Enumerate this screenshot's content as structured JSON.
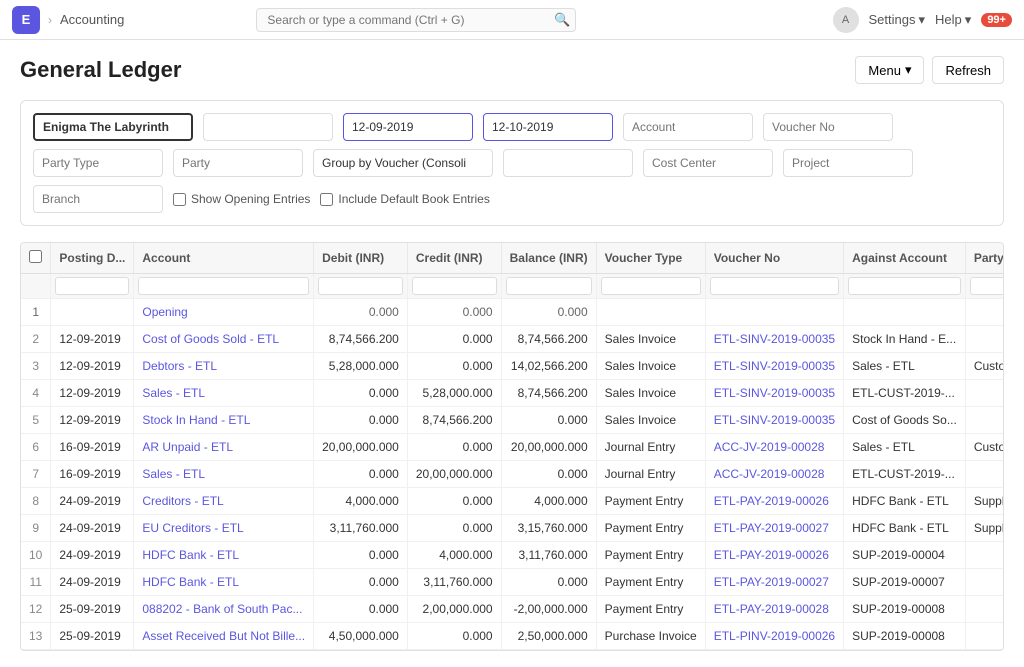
{
  "topbar": {
    "logo": "E",
    "module": "Accounting",
    "search_placeholder": "Search or type a command (Ctrl + G)",
    "avatar_label": "A",
    "settings_label": "Settings",
    "help_label": "Help",
    "badge": "99+"
  },
  "page": {
    "title": "General Ledger",
    "menu_label": "Menu",
    "refresh_label": "Refresh"
  },
  "filters": {
    "company": "Enigma The Labyrinth",
    "finance_book": "",
    "from_date": "12-09-2019",
    "to_date": "12-10-2019",
    "account": "",
    "voucher_no": "",
    "party_type": "",
    "party": "",
    "group_by": "Group by Voucher (Consoli",
    "col6_blank": "",
    "cost_center": "",
    "project": "",
    "branch": "",
    "show_opening_entries": false,
    "include_default_book_entries": false,
    "show_opening_label": "Show Opening Entries",
    "include_default_label": "Include Default Book Entries"
  },
  "table": {
    "columns": [
      "",
      "Posting D...",
      "Account",
      "Debit (INR)",
      "Credit (INR)",
      "Balance (INR)",
      "Voucher Type",
      "Voucher No",
      "Against Account",
      "Party Type"
    ],
    "rows": [
      {
        "num": "1",
        "posting_date": "",
        "account": "Opening",
        "debit": "0.000",
        "credit": "0.000",
        "balance": "0.000",
        "voucher_type": "",
        "voucher_no": "",
        "against_account": "",
        "party_type": ""
      },
      {
        "num": "2",
        "posting_date": "12-09-2019",
        "account": "Cost of Goods Sold - ETL",
        "debit": "8,74,566.200",
        "credit": "0.000",
        "balance": "8,74,566.200",
        "voucher_type": "Sales Invoice",
        "voucher_no": "ETL-SINV-2019-00035",
        "against_account": "Stock In Hand - E...",
        "party_type": ""
      },
      {
        "num": "3",
        "posting_date": "12-09-2019",
        "account": "Debtors - ETL",
        "debit": "5,28,000.000",
        "credit": "0.000",
        "balance": "14,02,566.200",
        "voucher_type": "Sales Invoice",
        "voucher_no": "ETL-SINV-2019-00035",
        "against_account": "Sales - ETL",
        "party_type": "Customer"
      },
      {
        "num": "4",
        "posting_date": "12-09-2019",
        "account": "Sales - ETL",
        "debit": "0.000",
        "credit": "5,28,000.000",
        "balance": "8,74,566.200",
        "voucher_type": "Sales Invoice",
        "voucher_no": "ETL-SINV-2019-00035",
        "against_account": "ETL-CUST-2019-...",
        "party_type": ""
      },
      {
        "num": "5",
        "posting_date": "12-09-2019",
        "account": "Stock In Hand - ETL",
        "debit": "0.000",
        "credit": "8,74,566.200",
        "balance": "0.000",
        "voucher_type": "Sales Invoice",
        "voucher_no": "ETL-SINV-2019-00035",
        "against_account": "Cost of Goods So...",
        "party_type": ""
      },
      {
        "num": "6",
        "posting_date": "16-09-2019",
        "account": "AR Unpaid - ETL",
        "debit": "20,00,000.000",
        "credit": "0.000",
        "balance": "20,00,000.000",
        "voucher_type": "Journal Entry",
        "voucher_no": "ACC-JV-2019-00028",
        "against_account": "Sales - ETL",
        "party_type": "Customer"
      },
      {
        "num": "7",
        "posting_date": "16-09-2019",
        "account": "Sales - ETL",
        "debit": "0.000",
        "credit": "20,00,000.000",
        "balance": "0.000",
        "voucher_type": "Journal Entry",
        "voucher_no": "ACC-JV-2019-00028",
        "against_account": "ETL-CUST-2019-...",
        "party_type": ""
      },
      {
        "num": "8",
        "posting_date": "24-09-2019",
        "account": "Creditors - ETL",
        "debit": "4,000.000",
        "credit": "0.000",
        "balance": "4,000.000",
        "voucher_type": "Payment Entry",
        "voucher_no": "ETL-PAY-2019-00026",
        "against_account": "HDFC Bank - ETL",
        "party_type": "Supplier"
      },
      {
        "num": "9",
        "posting_date": "24-09-2019",
        "account": "EU Creditors - ETL",
        "debit": "3,11,760.000",
        "credit": "0.000",
        "balance": "3,15,760.000",
        "voucher_type": "Payment Entry",
        "voucher_no": "ETL-PAY-2019-00027",
        "against_account": "HDFC Bank - ETL",
        "party_type": "Supplier"
      },
      {
        "num": "10",
        "posting_date": "24-09-2019",
        "account": "HDFC Bank - ETL",
        "debit": "0.000",
        "credit": "4,000.000",
        "balance": "3,11,760.000",
        "voucher_type": "Payment Entry",
        "voucher_no": "ETL-PAY-2019-00026",
        "against_account": "SUP-2019-00004",
        "party_type": ""
      },
      {
        "num": "11",
        "posting_date": "24-09-2019",
        "account": "HDFC Bank - ETL",
        "debit": "0.000",
        "credit": "3,11,760.000",
        "balance": "0.000",
        "voucher_type": "Payment Entry",
        "voucher_no": "ETL-PAY-2019-00027",
        "against_account": "SUP-2019-00007",
        "party_type": ""
      },
      {
        "num": "12",
        "posting_date": "25-09-2019",
        "account": "088202 - Bank of South Pac...",
        "debit": "0.000",
        "credit": "2,00,000.000",
        "balance": "-2,00,000.000",
        "voucher_type": "Payment Entry",
        "voucher_no": "ETL-PAY-2019-00028",
        "against_account": "SUP-2019-00008",
        "party_type": ""
      },
      {
        "num": "13",
        "posting_date": "25-09-2019",
        "account": "Asset Received But Not Bille...",
        "debit": "4,50,000.000",
        "credit": "0.000",
        "balance": "2,50,000.000",
        "voucher_type": "Purchase Invoice",
        "voucher_no": "ETL-PINV-2019-00026",
        "against_account": "SUP-2019-00008",
        "party_type": ""
      }
    ]
  }
}
